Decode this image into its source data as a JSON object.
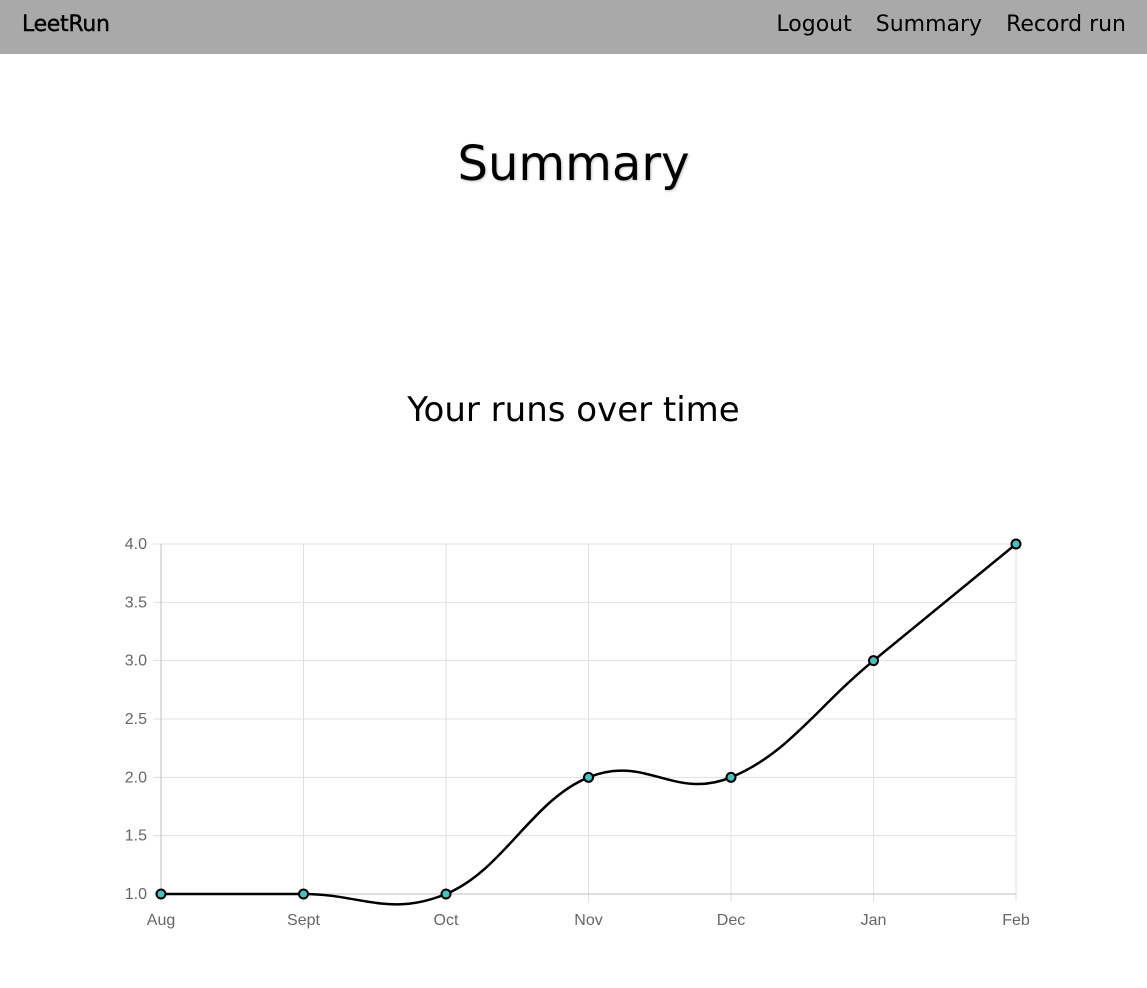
{
  "navbar": {
    "brand": "LeetRun",
    "links": [
      "Logout",
      "Summary",
      "Record run"
    ],
    "background": "#a9a9a9"
  },
  "page": {
    "title": "Summary",
    "chart_heading": "Your runs over time"
  },
  "chart_data": {
    "type": "line",
    "categories": [
      "Aug",
      "Sept",
      "Oct",
      "Nov",
      "Dec",
      "Jan",
      "Feb"
    ],
    "series": [
      {
        "values": [
          1,
          1,
          1,
          2,
          2,
          3,
          4
        ]
      }
    ],
    "ylim": [
      1.0,
      4.0
    ],
    "yticks": [
      "1.0",
      "1.5",
      "2.0",
      "2.5",
      "3.0",
      "3.5",
      "4.0"
    ],
    "grid": true,
    "legend": "none",
    "line_color": "#000000",
    "point_color": "#4bc0c0"
  }
}
